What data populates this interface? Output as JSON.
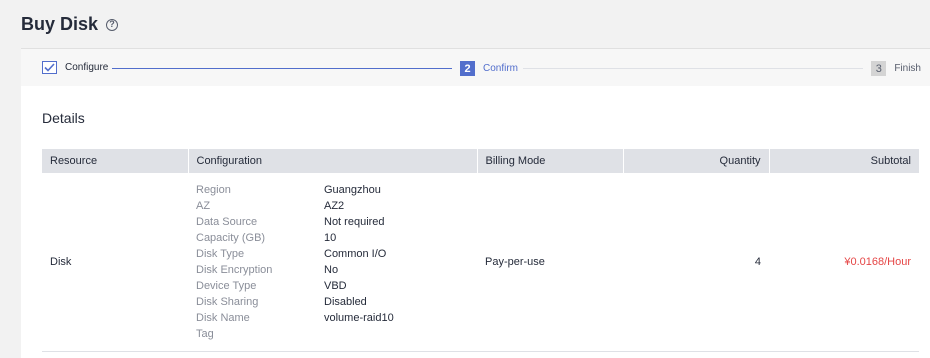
{
  "header": {
    "title": "Buy Disk",
    "help_icon": "?"
  },
  "steps": [
    {
      "label": "Configure",
      "state": "done"
    },
    {
      "number": "2",
      "label": "Confirm",
      "state": "active"
    },
    {
      "number": "3",
      "label": "Finish",
      "state": "pending"
    }
  ],
  "details": {
    "title": "Details",
    "columns": [
      "Resource",
      "Configuration",
      "Billing Mode",
      "Quantity",
      "Subtotal"
    ],
    "row": {
      "resource": "Disk",
      "configuration": [
        {
          "key": "Region",
          "value": "Guangzhou"
        },
        {
          "key": "AZ",
          "value": "AZ2"
        },
        {
          "key": "Data Source",
          "value": "Not required"
        },
        {
          "key": "Capacity (GB)",
          "value": "10"
        },
        {
          "key": "Disk Type",
          "value": "Common I/O"
        },
        {
          "key": "Disk Encryption",
          "value": "No"
        },
        {
          "key": "Device Type",
          "value": "VBD"
        },
        {
          "key": "Disk Sharing",
          "value": "Disabled"
        },
        {
          "key": "Disk Name",
          "value": "volume-raid10"
        },
        {
          "key": "Tag",
          "value": ""
        }
      ],
      "billing_mode": "Pay-per-use",
      "quantity": "4",
      "subtotal": "¥0.0168/Hour"
    }
  },
  "colors": {
    "accent": "#526ecc",
    "price": "#e54545",
    "header_bg": "#dfe1e6"
  }
}
